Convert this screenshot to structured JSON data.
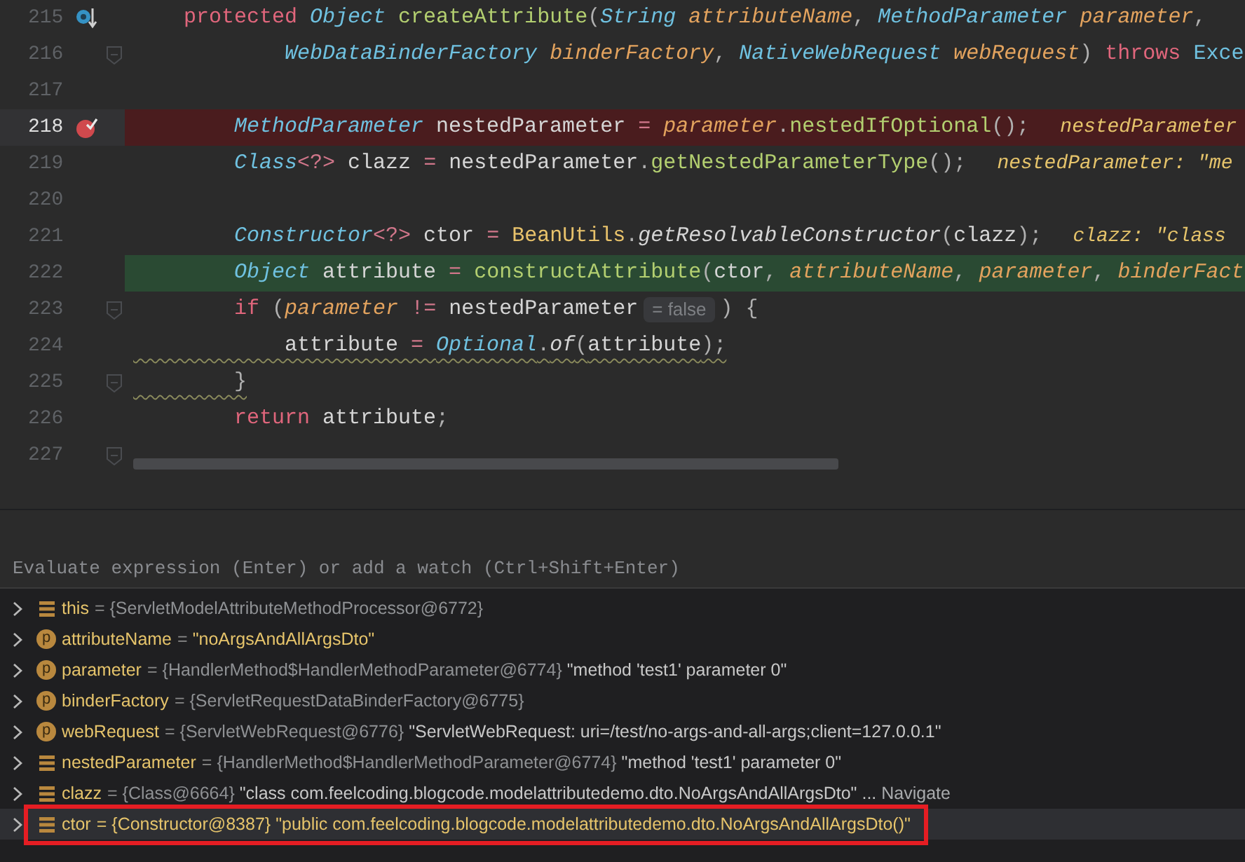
{
  "editor": {
    "lines": [
      {
        "number": "215",
        "kind": "normal",
        "caret": false,
        "gutter_icon": {
          "kind": "method-breakpoint"
        },
        "segments": [
          {
            "kind": "code",
            "tokens": [
              {
                "kind": "kw",
                "t": "    protected "
              },
              {
                "kind": "type",
                "t": "Object "
              },
              {
                "kind": "fn",
                "t": "createAttribute"
              },
              {
                "kind": "punct",
                "t": "("
              },
              {
                "kind": "type",
                "t": "String "
              },
              {
                "kind": "param",
                "t": "attributeName"
              },
              {
                "kind": "punct",
                "t": ", "
              },
              {
                "kind": "type",
                "t": "MethodParameter "
              },
              {
                "kind": "param",
                "t": "parameter"
              },
              {
                "kind": "punct",
                "t": ","
              }
            ]
          }
        ]
      },
      {
        "number": "216",
        "kind": "normal",
        "caret": false,
        "fold_marker": true,
        "segments": [
          {
            "kind": "code",
            "tokens": [
              {
                "kind": "type",
                "t": "            WebDataBinderFactory "
              },
              {
                "kind": "param",
                "t": "binderFactory"
              },
              {
                "kind": "punct",
                "t": ", "
              },
              {
                "kind": "type",
                "t": "NativeWebRequest "
              },
              {
                "kind": "param",
                "t": "webRequest"
              },
              {
                "kind": "punct",
                "t": ") "
              },
              {
                "kind": "kw",
                "t": "throws "
              },
              {
                "kind": "class",
                "t": "Exce"
              }
            ]
          }
        ]
      },
      {
        "number": "217",
        "kind": "normal",
        "caret": false
      },
      {
        "number": "218",
        "kind": "breakpoint",
        "caret": true,
        "gutter_icon": {
          "kind": "breakpoint"
        },
        "segments": [
          {
            "kind": "code",
            "tokens": [
              {
                "kind": "type",
                "t": "        MethodParameter "
              },
              {
                "kind": "var",
                "t": "nestedParameter"
              },
              {
                "kind": "op",
                "t": " = "
              },
              {
                "kind": "param",
                "t": "parameter"
              },
              {
                "kind": "punct",
                "t": "."
              },
              {
                "kind": "fn",
                "t": "nestedIfOptional"
              },
              {
                "kind": "punct",
                "t": "();"
              }
            ]
          },
          {
            "kind": "hint",
            "text": "nestedParameter"
          }
        ]
      },
      {
        "number": "219",
        "kind": "normal",
        "caret": false,
        "segments": [
          {
            "kind": "code",
            "tokens": [
              {
                "kind": "type",
                "t": "        Class"
              },
              {
                "kind": "op",
                "t": "<?> "
              },
              {
                "kind": "var",
                "t": "clazz"
              },
              {
                "kind": "op",
                "t": " = "
              },
              {
                "kind": "var",
                "t": "nestedParameter"
              },
              {
                "kind": "punct",
                "t": "."
              },
              {
                "kind": "fn",
                "t": "getNestedParameterType"
              },
              {
                "kind": "punct",
                "t": "();"
              }
            ]
          },
          {
            "kind": "hint",
            "text": "nestedParameter: \"me"
          }
        ]
      },
      {
        "number": "220",
        "kind": "normal",
        "caret": false
      },
      {
        "number": "221",
        "kind": "normal",
        "caret": false,
        "segments": [
          {
            "kind": "code",
            "tokens": [
              {
                "kind": "type",
                "t": "        Constructor"
              },
              {
                "kind": "op",
                "t": "<?> "
              },
              {
                "kind": "var",
                "t": "ctor"
              },
              {
                "kind": "op",
                "t": " = "
              },
              {
                "kind": "static",
                "t": "BeanUtils"
              },
              {
                "kind": "punct",
                "t": "."
              },
              {
                "kind": "sfn",
                "t": "getResolvableConstructor"
              },
              {
                "kind": "punct",
                "t": "("
              },
              {
                "kind": "var",
                "t": "clazz"
              },
              {
                "kind": "punct",
                "t": ");"
              }
            ]
          },
          {
            "kind": "hint",
            "text": "clazz: \"class"
          }
        ]
      },
      {
        "number": "222",
        "kind": "execution",
        "caret": false,
        "segments": [
          {
            "kind": "code",
            "tokens": [
              {
                "kind": "type",
                "t": "        Object "
              },
              {
                "kind": "var",
                "t": "attribute"
              },
              {
                "kind": "op",
                "t": " = "
              },
              {
                "kind": "fn",
                "t": "constructAttribute"
              },
              {
                "kind": "punct",
                "t": "("
              },
              {
                "kind": "var",
                "t": "ctor"
              },
              {
                "kind": "punct",
                "t": ", "
              },
              {
                "kind": "param",
                "t": "attributeName"
              },
              {
                "kind": "punct",
                "t": ", "
              },
              {
                "kind": "param",
                "t": "parameter"
              },
              {
                "kind": "punct",
                "t": ", "
              },
              {
                "kind": "param",
                "t": "binderFact"
              }
            ]
          }
        ]
      },
      {
        "number": "223",
        "kind": "normal",
        "caret": false,
        "fold_marker": true,
        "segments": [
          {
            "kind": "code",
            "tokens": [
              {
                "kind": "kw",
                "t": "        if "
              },
              {
                "kind": "punct",
                "t": "("
              },
              {
                "kind": "param",
                "t": "parameter"
              },
              {
                "kind": "op",
                "t": " != "
              },
              {
                "kind": "var",
                "t": "nestedParameter"
              }
            ]
          },
          {
            "kind": "inline-value",
            "text": "= false"
          },
          {
            "kind": "code",
            "tokens": [
              {
                "kind": "punct",
                "t": ") {"
              }
            ]
          }
        ]
      },
      {
        "number": "224",
        "kind": "normal",
        "caret": false,
        "warning": true,
        "segments": [
          {
            "kind": "code",
            "tokens": [
              {
                "kind": "var",
                "t": "            attribute"
              },
              {
                "kind": "op",
                "t": " = "
              },
              {
                "kind": "type",
                "t": "Optional"
              },
              {
                "kind": "punct",
                "t": "."
              },
              {
                "kind": "sfn",
                "t": "of"
              },
              {
                "kind": "punct",
                "t": "("
              },
              {
                "kind": "var",
                "t": "attribute"
              },
              {
                "kind": "punct",
                "t": ");"
              }
            ]
          }
        ]
      },
      {
        "number": "225",
        "kind": "normal",
        "caret": false,
        "fold_marker": true,
        "warning": true,
        "segments": [
          {
            "kind": "code",
            "tokens": [
              {
                "kind": "punct",
                "t": "        }"
              }
            ]
          }
        ]
      },
      {
        "number": "226",
        "kind": "normal",
        "caret": false,
        "segments": [
          {
            "kind": "code",
            "tokens": [
              {
                "kind": "kw",
                "t": "        return "
              },
              {
                "kind": "var",
                "t": "attribute"
              },
              {
                "kind": "punct",
                "t": ";"
              }
            ]
          }
        ]
      },
      {
        "number": "227",
        "kind": "normal",
        "caret": false,
        "fold_marker": true
      }
    ]
  },
  "debugger": {
    "evaluate_field": {
      "placeholder": "Evaluate expression (Enter) or add a watch (Ctrl+Shift+Enter)"
    },
    "variables": [
      {
        "icon": {
          "kind": "field"
        },
        "name": "this",
        "selected": false,
        "value": [
          {
            "kind": "op",
            "t": "="
          },
          {
            "kind": "ref",
            "t": "{ServletModelAttributeMethodProcessor@6772}"
          }
        ]
      },
      {
        "icon": {
          "kind": "param",
          "letter": "p"
        },
        "name": "attributeName",
        "selected": false,
        "value": [
          {
            "kind": "op",
            "t": "="
          },
          {
            "kind": "literal",
            "t": "\"noArgsAndAllArgsDto\""
          }
        ]
      },
      {
        "icon": {
          "kind": "param",
          "letter": "p"
        },
        "name": "parameter",
        "selected": false,
        "value": [
          {
            "kind": "op",
            "t": "="
          },
          {
            "kind": "ref",
            "t": "{HandlerMethod$HandlerMethodParameter@6774}"
          },
          {
            "kind": "text",
            "t": "\"method 'test1' parameter 0\""
          }
        ]
      },
      {
        "icon": {
          "kind": "param",
          "letter": "p"
        },
        "name": "binderFactory",
        "selected": false,
        "value": [
          {
            "kind": "op",
            "t": "="
          },
          {
            "kind": "ref",
            "t": "{ServletRequestDataBinderFactory@6775}"
          }
        ]
      },
      {
        "icon": {
          "kind": "param",
          "letter": "p"
        },
        "name": "webRequest",
        "selected": false,
        "value": [
          {
            "kind": "op",
            "t": "="
          },
          {
            "kind": "ref",
            "t": "{ServletWebRequest@6776}"
          },
          {
            "kind": "text",
            "t": "\"ServletWebRequest: uri=/test/no-args-and-all-args;client=127.0.0.1\""
          }
        ]
      },
      {
        "icon": {
          "kind": "field"
        },
        "name": "nestedParameter",
        "selected": false,
        "value": [
          {
            "kind": "op",
            "t": "="
          },
          {
            "kind": "ref",
            "t": "{HandlerMethod$HandlerMethodParameter@6774}"
          },
          {
            "kind": "text",
            "t": "\"method 'test1' parameter 0\""
          }
        ]
      },
      {
        "icon": {
          "kind": "field"
        },
        "name": "clazz",
        "selected": false,
        "value": [
          {
            "kind": "op",
            "t": "="
          },
          {
            "kind": "ref",
            "t": "{Class@6664}"
          },
          {
            "kind": "text",
            "t": "\"class com.feelcoding.blogcode.modelattributedemo.dto.NoArgsAndAllArgsDto\""
          },
          {
            "kind": "text",
            "t": "..."
          },
          {
            "kind": "link",
            "t": "Navigate"
          }
        ]
      },
      {
        "icon": {
          "kind": "field"
        },
        "name": "ctor",
        "selected": true,
        "annotated": true,
        "value": [
          {
            "kind": "op",
            "t": "="
          },
          {
            "kind": "ref",
            "t": "{Constructor@8387}"
          },
          {
            "kind": "text",
            "t": "\"public com.feelcoding.blogcode.modelattributedemo.dto.NoArgsAndAllArgsDto()\""
          }
        ]
      }
    ]
  }
}
